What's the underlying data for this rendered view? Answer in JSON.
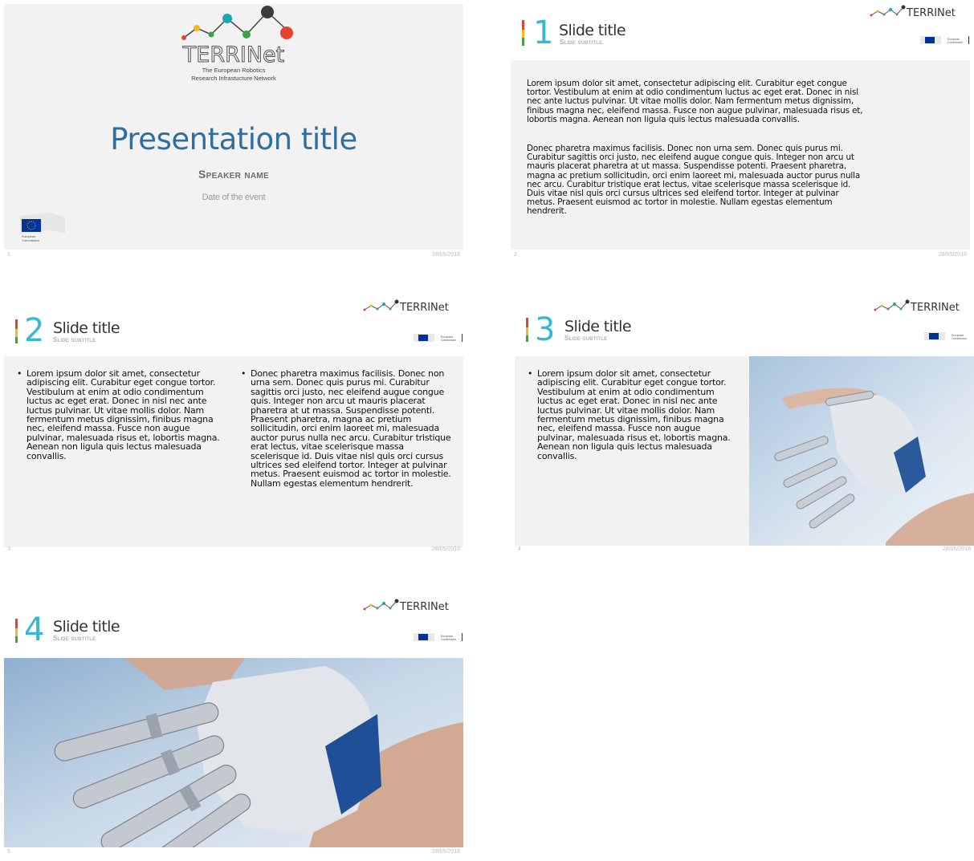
{
  "slide1": {
    "logo_word": "TERRINet",
    "logo_line1": "The European Robotics",
    "logo_line2": "Research Infrastucture Network",
    "presentation_title": "Presentation title",
    "speaker_name": "Speaker name",
    "event_date": "Date of the event",
    "slide_number": "1",
    "date": "28/05/2018"
  },
  "slide2": {
    "number": "1",
    "title": "Slide title",
    "subtitle": "Slide subtitle",
    "paragraph1": "Lorem ipsum dolor sit amet, consectetur adipiscing elit. Curabitur eget congue tortor. Vestibulum at enim at odio condimentum luctus ac eget erat. Donec in nisl nec ante luctus pulvinar. Ut vitae mollis dolor. Nam fermentum metus dignissim, finibus magna nec, eleifend massa. Fusce non augue pulvinar, malesuada risus et, lobortis magna. Aenean non ligula quis lectus malesuada convallis.",
    "paragraph2": "Donec pharetra maximus facilisis. Donec non urna sem. Donec quis purus mi. Curabitur sagittis orci justo, nec eleifend augue congue quis. Integer non arcu ut mauris placerat pharetra at ut massa. Suspendisse potenti. Praesent pharetra, magna ac pretium sollicitudin, orci enim laoreet mi, malesuada auctor purus nulla nec arcu. Curabitur tristique erat lectus, vitae scelerisque massa scelerisque id. Duis vitae nisl quis orci cursus ultrices sed eleifend tortor. Integer at pulvinar metus. Praesent euismod ac tortor in molestie. Nullam egestas elementum hendrerit.",
    "slide_number": "2",
    "date": "28/05/2018"
  },
  "slide3": {
    "number": "2",
    "title": "Slide title",
    "subtitle": "Slide subtitle",
    "bullet1": "Lorem ipsum dolor sit amet, consectetur adipiscing elit. Curabitur eget congue tortor. Vestibulum at enim at odio condimentum luctus ac eget erat. Donec in nisl nec ante luctus pulvinar. Ut vitae mollis dolor. Nam fermentum metus dignissim, finibus magna nec, eleifend massa. Fusce non augue pulvinar, malesuada risus et, lobortis magna. Aenean non ligula quis lectus malesuada convallis.",
    "bullet2": "Donec pharetra maximus facilisis. Donec non urna sem. Donec quis purus mi. Curabitur sagittis orci justo, nec eleifend augue congue quis. Integer non arcu ut mauris placerat pharetra at ut massa. Suspendisse potenti. Praesent pharetra, magna ac pretium sollicitudin, orci enim laoreet mi, malesuada auctor purus nulla nec arcu. Curabitur tristique erat lectus, vitae scelerisque massa scelerisque id. Duis vitae nisl quis orci cursus ultrices sed eleifend tortor. Integer at pulvinar metus. Praesent euismod ac tortor in molestie. Nullam egestas elementum hendrerit.",
    "slide_number": "3",
    "date": "28/05/2018"
  },
  "slide4": {
    "number": "3",
    "title": "Slide title",
    "subtitle": "Slide subtitle",
    "bullet1": "Lorem ipsum dolor sit amet, consectetur adipiscing elit. Curabitur eget congue tortor. Vestibulum at enim at odio condimentum luctus ac eget erat. Donec in nisl nec ante luctus pulvinar. Ut vitae mollis dolor. Nam fermentum metus dignissim, finibus magna nec, eleifend massa. Fusce non augue pulvinar, malesuada risus et, lobortis magna. Aenean non ligula quis lectus malesuada convallis.",
    "slide_number": "4",
    "date": "28/05/2018"
  },
  "slide5": {
    "number": "4",
    "title": "Slide title",
    "subtitle": "Slide subtitle",
    "slide_number": "5",
    "date": "28/05/2018"
  },
  "logo_small_word": "TERRINet",
  "ec_label_line1": "European",
  "ec_label_line2": "Commission",
  "colors": {
    "accent_blue": "#35b8d3",
    "title_blue": "#2f6f9f",
    "panel_gray": "#f2f2f2",
    "logo_red": "#e8412f",
    "logo_yellow": "#f3b81e",
    "logo_green": "#3aa347",
    "logo_teal": "#1aa6b7",
    "eu_blue": "#003399"
  }
}
